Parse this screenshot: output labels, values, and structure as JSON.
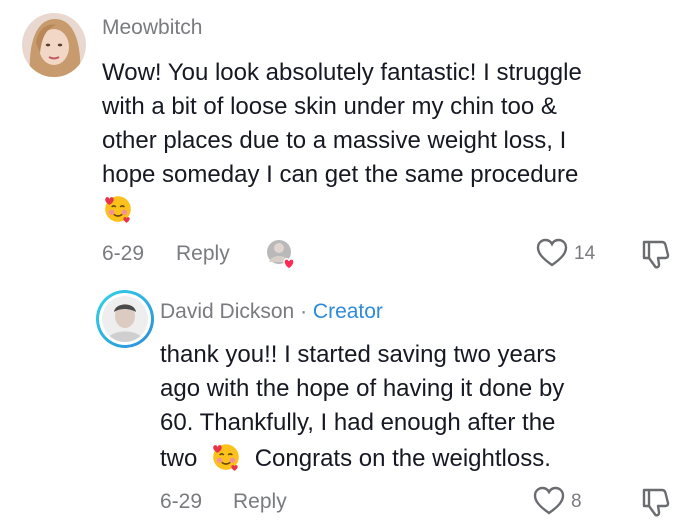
{
  "comment": {
    "username": "Meowbitch",
    "text_lines": [
      "Wow! You look absolutely fantastic! I struggle",
      "with a bit of loose skin under my chin too &",
      "other places due to a massive weight loss, I",
      "hope someday I can get the same procedure"
    ],
    "date": "6-29",
    "reply_label": "Reply",
    "like_count": "14"
  },
  "reply": {
    "username": "David Dickson",
    "separator": "·",
    "creator_label": "Creator",
    "text_lines": [
      "thank you!! I started saving two years",
      "ago with the hope of having it done by",
      "60. Thankfully, I had enough after the"
    ],
    "last_line_before_emoji": "two",
    "last_line_after_emoji": "Congrats on the weightloss.",
    "date": "6-29",
    "reply_label": "Reply",
    "like_count": "8"
  },
  "colors": {
    "text": "#161823",
    "muted": "#7a7b80",
    "creator": "#2e8bd9",
    "heart_badge": "#fe2c55"
  },
  "icons": [
    "smiling-face-with-hearts-emoji",
    "heart-outline-icon",
    "dislike-icon",
    "creator-liked-badge"
  ]
}
